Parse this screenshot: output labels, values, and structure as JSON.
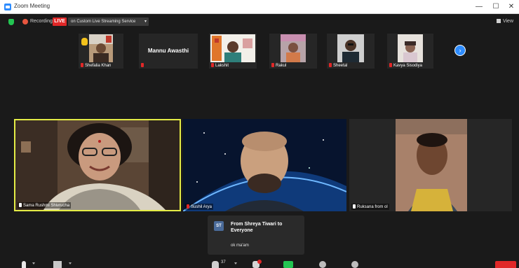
{
  "window": {
    "title": "Zoom Meeting",
    "minimize": "—",
    "maximize": "☐",
    "close": "✕"
  },
  "top_bar": {
    "recording_label": "Recording",
    "live_badge": "LIVE",
    "stream_target": "on Custom Live Streaming Service",
    "view_label": "View"
  },
  "thumbnails": [
    {
      "name": "Shefalia Khan",
      "hand_raised": true
    },
    {
      "name": "",
      "display_name": "Mannu Awasthi"
    },
    {
      "name": "Lakshit"
    },
    {
      "name": "Rakul"
    },
    {
      "name": "Sheetal"
    },
    {
      "name": "Kavya Sisodiya"
    }
  ],
  "next_page_icon": "chevron-right-icon",
  "tiles": [
    {
      "name": "Sama Rushmi Shivrucha",
      "active_speaker": true
    },
    {
      "name": "Sushil Arya"
    },
    {
      "name": "Ruksana from ol"
    }
  ],
  "chat_notification": {
    "initials": "ST",
    "from": "From Shreya Tiwari to Everyone",
    "message": "ok ma'am"
  },
  "toolbar": {
    "participant_count": "37"
  },
  "colors": {
    "active_speaker_border": "#e4ec46",
    "live_red": "#e02828",
    "share_green": "#23c552",
    "accent_blue": "#2d8cff"
  }
}
